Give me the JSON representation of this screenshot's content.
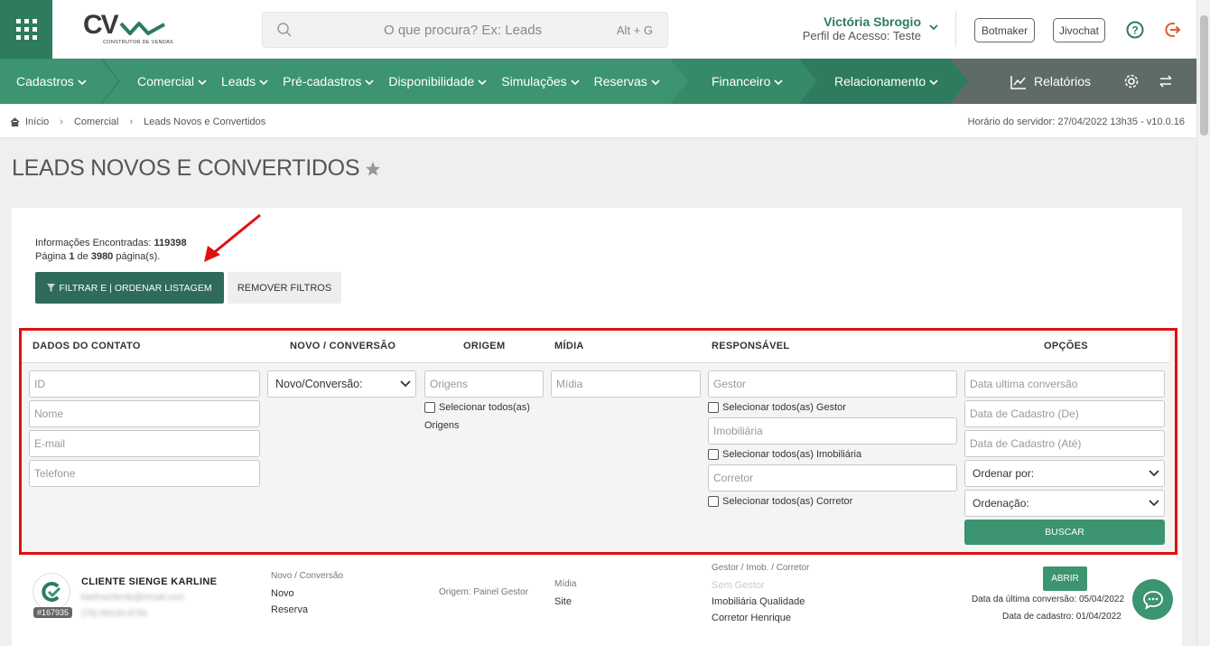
{
  "header": {
    "logo_text": "CV",
    "logo_sub": "CONSTRUTOR DE VENDAS",
    "search_placeholder": "O que procura? Ex: Leads",
    "search_shortcut": "Alt + G",
    "user_name": "Victória Sbrogio",
    "user_profile": "Perfil de Acesso: Teste",
    "btn_botmaker": "Botmaker",
    "btn_jivochat": "Jivochat"
  },
  "nav": {
    "items": [
      "Cadastros",
      "Comercial",
      "Leads",
      "Pré-cadastros",
      "Disponibilidade",
      "Simulações",
      "Reservas",
      "Financeiro",
      "Relacionamento"
    ],
    "reports": "Relatórios"
  },
  "breadcrumb": {
    "items": [
      "Início",
      "Comercial",
      "Leads Novos e Convertidos"
    ],
    "server_time": "Horário do servidor: 27/04/2022 13h35 - v10.0.16"
  },
  "page": {
    "title": "LEADS NOVOS E CONVERTIDOS",
    "info_found_label": "Informações Encontradas:",
    "info_found_value": "119398",
    "page_label": "Página",
    "page_current": "1",
    "page_of": "de",
    "page_total": "3980",
    "page_suffix": "página(s).",
    "btn_filter": "FILTRAR E | ORDENAR LISTAGEM",
    "btn_remove": "REMOVER FILTROS"
  },
  "filters": {
    "headers": [
      "DADOS DO CONTATO",
      "NOVO / CONVERSÃO",
      "ORIGEM",
      "MÍDIA",
      "RESPONSÁVEL",
      "OPÇÕES"
    ],
    "id_ph": "ID",
    "nome_ph": "Nome",
    "email_ph": "E-mail",
    "telefone_ph": "Telefone",
    "novo_conv_select": "Novo/Conversão:",
    "origens_ph": "Origens",
    "origens_check": "Selecionar todos(as)",
    "origens_check2": "Origens",
    "midia_ph": "Mídia",
    "gestor_ph": "Gestor",
    "gestor_check": "Selecionar todos(as) Gestor",
    "imobiliaria_ph": "Imobiliária",
    "imobiliaria_check": "Selecionar todos(as) Imobiliária",
    "corretor_ph": "Corretor",
    "corretor_check": "Selecionar todos(as) Corretor",
    "data_ultima_ph": "Data ultima conversão",
    "data_cad_de_ph": "Data de Cadastro (De)",
    "data_cad_ate_ph": "Data de Cadastro (Até)",
    "ordenar_por": "Ordenar por:",
    "ordenacao": "Ordenação:",
    "btn_buscar": "BUSCAR"
  },
  "lead_row": {
    "name": "CLIENTE SIENGE KARLINE",
    "email_blurred": "karlinecliente@email.com",
    "phone_blurred": "(79) 99100-8791",
    "id_badge": "#167935",
    "novo_conv_label": "Novo / Conversão",
    "novo": "Novo",
    "reserva": "Reserva",
    "origem": "Origem: Painel Gestor",
    "midia_label": "Mídia",
    "midia_value": "Site",
    "resp_label": "Gestor / Imob. / Corretor",
    "sem_gestor": "Sem Gestor",
    "imobiliaria": "Imobiliária Qualidade",
    "corretor": "Corretor Henrique",
    "btn_abrir": "ABRIR",
    "data_ultima": "Data da última conversão: 05/04/2022",
    "data_cadastro": "Data de cadastro: 01/04/2022"
  },
  "colors": {
    "brand_green": "#3c9470",
    "dark_green": "#2e7b5e",
    "highlight_red": "#e01010"
  }
}
